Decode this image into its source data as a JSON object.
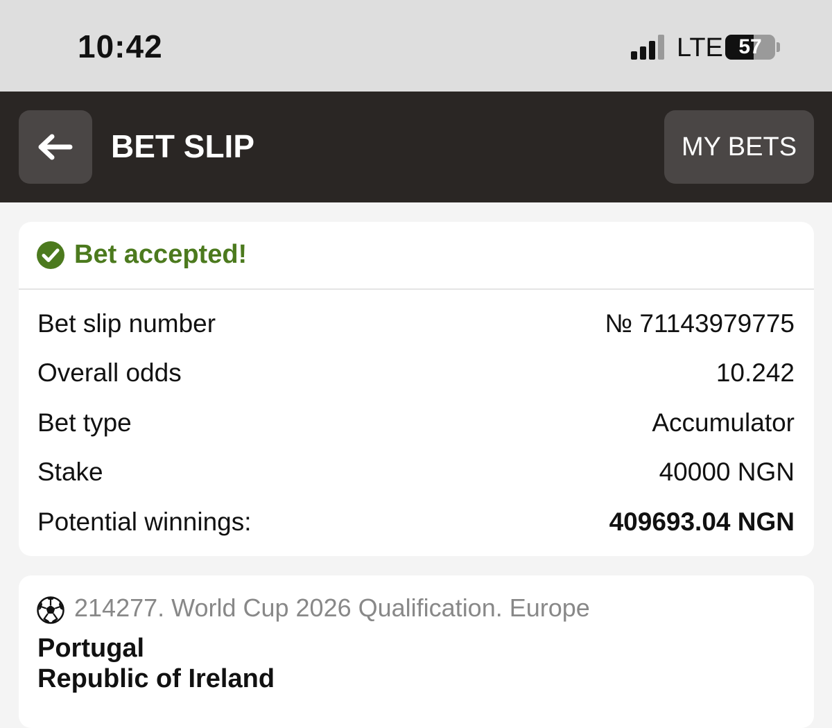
{
  "status_bar": {
    "time": "10:42",
    "network": "LTE",
    "battery": "57",
    "battery_level": 0.57
  },
  "header": {
    "title": "BET SLIP",
    "my_bets_label": "MY BETS",
    "back_icon": "arrow-left-icon"
  },
  "bet": {
    "status": "Bet accepted!",
    "status_icon": "check-circle-icon",
    "status_color": "#4c7a1e",
    "details": [
      {
        "label": "Bet slip number",
        "value": "№ 71143979775"
      },
      {
        "label": "Overall odds",
        "value": "10.242"
      },
      {
        "label": "Bet type",
        "value": "Accumulator"
      },
      {
        "label": "Stake",
        "value": "40000 NGN"
      },
      {
        "label": "Potential winnings:",
        "value": "409693.04 NGN"
      }
    ]
  },
  "event": {
    "icon": "soccer-ball-icon",
    "title": "214277. World Cup 2026 Qualification. Europe",
    "team_home": "Portugal",
    "team_away": "Republic of Ireland"
  }
}
